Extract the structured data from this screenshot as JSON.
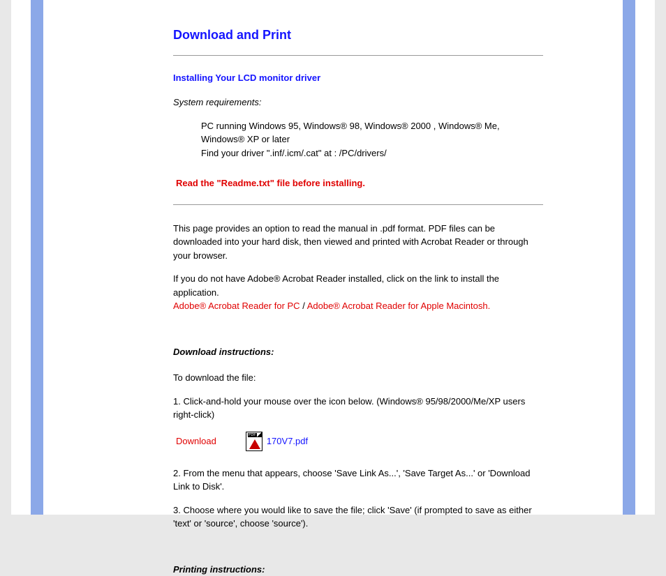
{
  "title": "Download and Print",
  "section1": {
    "heading": "Installing Your LCD monitor driver",
    "sysreq_label": "System requirements:",
    "req1": "PC running Windows 95, Windows® 98, Windows® 2000 , Windows® Me, Windows® XP or later",
    "req2": "Find your driver \".inf/.icm/.cat\" at : /PC/drivers/",
    "warning": "Read the \"Readme.txt\" file before installing."
  },
  "intro": {
    "p1": "This page provides an option to read the manual in .pdf format. PDF files can be downloaded into your hard disk, then viewed and printed with Acrobat Reader or through your browser.",
    "p2a": "If you do not have Adobe® Acrobat Reader installed, click on the link to install the application.",
    "link_pc": "Adobe® Acrobat Reader for PC",
    "sep": " / ",
    "link_mac": "Adobe® Acrobat Reader for Apple Macintosh."
  },
  "download": {
    "heading": "Download instructions:",
    "p1": "To download the file:",
    "step1": "1. Click-and-hold your mouse over the icon below. (Windows® 95/98/2000/Me/XP users right-click)",
    "label": "Download",
    "filename": "170V7.pdf",
    "step2": "2. From the menu that appears, choose 'Save Link As...', 'Save Target As...' or 'Download Link to Disk'.",
    "step3": "3. Choose where you would like to save the file; click 'Save' (if prompted to save as either 'text' or 'source', choose 'source')."
  },
  "printing": {
    "heading": "Printing instructions:"
  }
}
